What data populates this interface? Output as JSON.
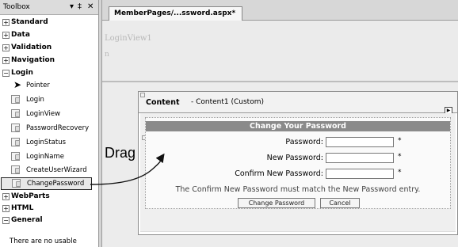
{
  "toolbox": {
    "title": "Toolbox",
    "controls": [
      "▾",
      "‡",
      "✕"
    ],
    "categories_top": [
      {
        "label": "Standard",
        "sign": "+"
      },
      {
        "label": "Data",
        "sign": "+"
      },
      {
        "label": "Validation",
        "sign": "+"
      },
      {
        "label": "Navigation",
        "sign": "+"
      },
      {
        "label": "Login",
        "sign": "−"
      }
    ],
    "login_tools": [
      {
        "label": "Pointer",
        "icon": "pointer-arrow-icon"
      },
      {
        "label": "Login",
        "icon": "login-icon"
      },
      {
        "label": "LoginView",
        "icon": "loginview-icon"
      },
      {
        "label": "PasswordRecovery",
        "icon": "passwordrecovery-icon"
      },
      {
        "label": "LoginStatus",
        "icon": "loginstatus-icon"
      },
      {
        "label": "LoginName",
        "icon": "loginname-icon"
      },
      {
        "label": "CreateUserWizard",
        "icon": "createuserwizard-icon"
      },
      {
        "label": "ChangePassword",
        "icon": "changepassword-icon",
        "selected": true
      }
    ],
    "categories_bottom": [
      {
        "label": "WebParts",
        "sign": "+"
      },
      {
        "label": "HTML",
        "sign": "+"
      },
      {
        "label": "General",
        "sign": "−"
      }
    ],
    "empty_message": "There are no usable"
  },
  "editor": {
    "tab_label": "MemberPages/...ssword.aspx*",
    "master_ghost_text": "LoginView1",
    "master_ghost_glyph": "n",
    "content_placeholder": {
      "title_main": "Content",
      "title_sub": "- Content1 (Custom)"
    },
    "change_password": {
      "header": "Change Your Password",
      "fields": [
        {
          "label": "Password:",
          "star": "*"
        },
        {
          "label": "New Password:",
          "star": "*"
        },
        {
          "label": "Confirm New Password:",
          "star": "*"
        }
      ],
      "mismatch_message": "The Confirm New Password must match the New Password entry.",
      "change_button": "Change Password",
      "cancel_button": "Cancel"
    }
  },
  "annotation": {
    "drag_label": "Drag"
  }
}
